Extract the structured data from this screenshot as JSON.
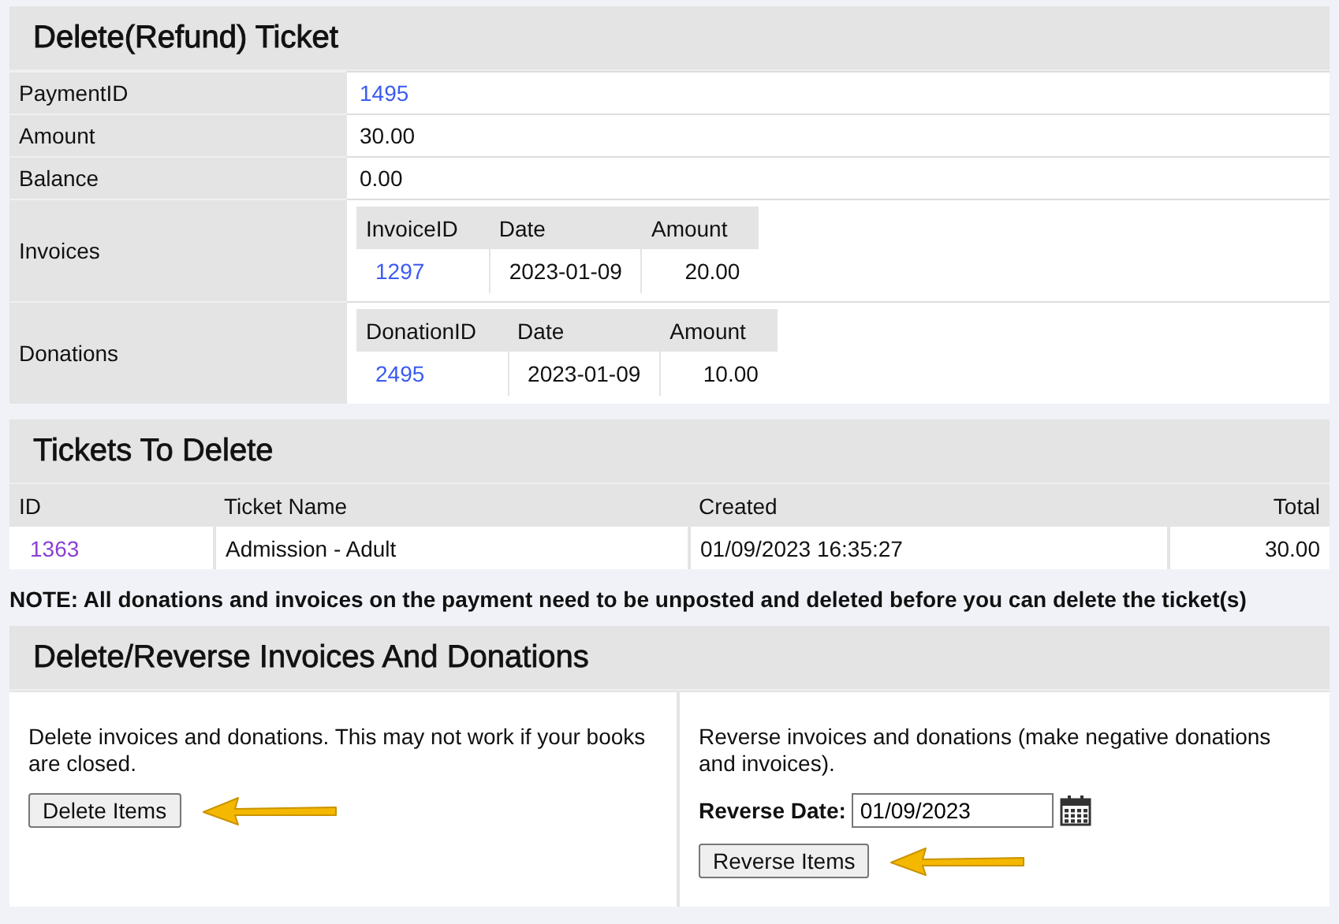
{
  "payment": {
    "title": "Delete(Refund) Ticket",
    "rows": [
      {
        "kind": "link",
        "label": "PaymentID",
        "value": "1495"
      },
      {
        "kind": "text",
        "label": "Amount",
        "value": "30.00"
      },
      {
        "kind": "text",
        "label": "Balance",
        "value": "0.00"
      },
      {
        "kind": "table",
        "label": "Invoices",
        "columns": [
          "InvoiceID",
          "Date",
          "Amount"
        ],
        "rows": [
          [
            "1297",
            "2023-01-09",
            "20.00"
          ]
        ]
      },
      {
        "kind": "table",
        "label": "Donations",
        "columns": [
          "DonationID",
          "Date",
          "Amount"
        ],
        "rows": [
          [
            "2495",
            "2023-01-09",
            "10.00"
          ]
        ]
      }
    ]
  },
  "tickets": {
    "title": "Tickets To Delete",
    "columns": [
      "ID",
      "Ticket Name",
      "Created",
      "Total"
    ],
    "rows": [
      [
        "1363",
        "Admission - Adult",
        "01/09/2023 16:35:27",
        "30.00"
      ]
    ]
  },
  "note": "NOTE: All donations and invoices on the payment need to be unposted and deleted before you can delete the ticket(s)",
  "actions": {
    "title": "Delete/Reverse Invoices And Donations",
    "delete": {
      "text": "Delete invoices and donations. This may not work if your books are closed.",
      "button": "Delete Items"
    },
    "reverse": {
      "text": "Reverse invoices and donations (make negative donations and invoices).",
      "date_label": "Reverse Date:",
      "date_value": "01/09/2023",
      "button": "Reverse Items"
    }
  }
}
